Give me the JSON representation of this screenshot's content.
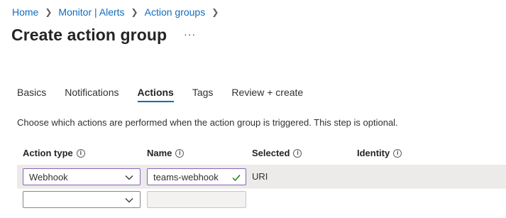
{
  "breadcrumb": {
    "items": [
      "Home",
      "Monitor | Alerts",
      "Action groups"
    ],
    "separator": ">"
  },
  "header": {
    "title": "Create action group",
    "more_label": "···"
  },
  "tabs": [
    {
      "label": "Basics",
      "active": false
    },
    {
      "label": "Notifications",
      "active": false
    },
    {
      "label": "Actions",
      "active": true
    },
    {
      "label": "Tags",
      "active": false
    },
    {
      "label": "Review + create",
      "active": false
    }
  ],
  "description": "Choose which actions are performed when the action group is triggered. This step is optional.",
  "table": {
    "columns": [
      {
        "label": "Action type",
        "info_icon": "info-icon"
      },
      {
        "label": "Name",
        "info_icon": "info-icon"
      },
      {
        "label": "Selected",
        "info_icon": "info-icon"
      },
      {
        "label": "Identity",
        "info_icon": "info-icon"
      }
    ],
    "rows": [
      {
        "action_type": "Webhook",
        "name": "teams-webhook",
        "name_valid": true,
        "selected": "URI",
        "identity": ""
      },
      {
        "action_type": "",
        "name": "",
        "name_valid": false,
        "selected": "",
        "identity": ""
      }
    ]
  },
  "colors": {
    "link": "#0f6cbd",
    "focus_border": "#8764b8",
    "valid_check": "#107c10",
    "selected_row_bg": "#edebe9"
  }
}
